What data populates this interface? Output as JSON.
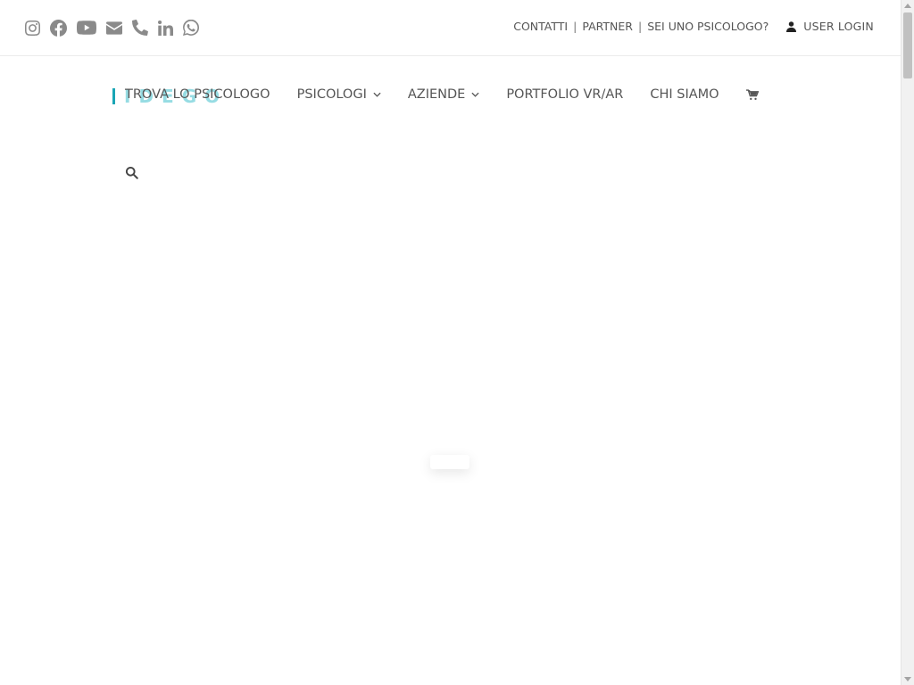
{
  "colors": {
    "accent": "#19b3c2",
    "icon_gray": "#8a8a8a",
    "text": "#555555",
    "divider": "#ebebeb"
  },
  "social_icons": [
    "instagram-icon",
    "facebook-icon",
    "youtube-icon",
    "envelope-icon",
    "phone-icon",
    "linkedin-icon",
    "whatsapp-icon"
  ],
  "top_links": {
    "contatti": "CONTATTI",
    "sep1": "|",
    "partner": "PARTNER",
    "sep2": "|",
    "psicologo": "SEI UNO PSICOLOGO?",
    "login": "USER LOGIN"
  },
  "logo": {
    "text": "IDEGO"
  },
  "nav": {
    "trova": "TROVA LO PSICOLOGO",
    "psicologi": "PSICOLOGI",
    "aziende": "AZIENDE",
    "portfolio": "PORTFOLIO VR/AR",
    "chi_siamo": "CHI SIAMO"
  }
}
